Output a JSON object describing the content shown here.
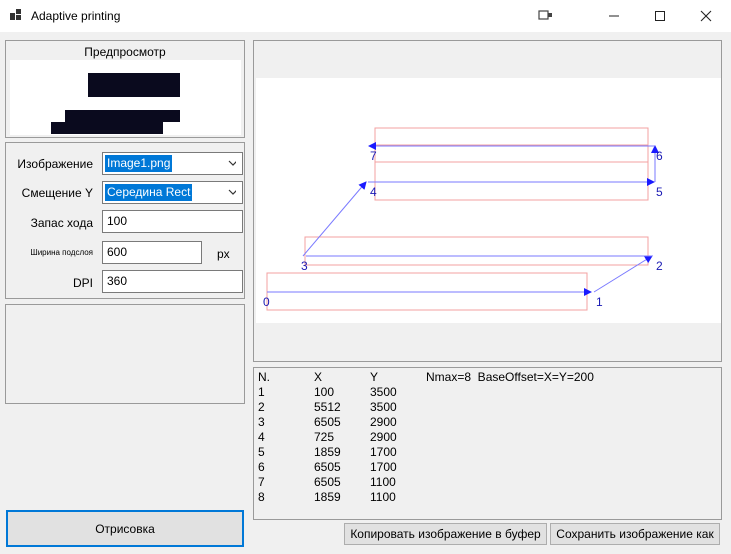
{
  "window": {
    "title": "Adaptive printing",
    "controls": [
      "minimize-icon",
      "maximize-icon",
      "close-icon"
    ]
  },
  "preview": {
    "title": "Предпросмотр"
  },
  "settings": {
    "image_label": "Изображение",
    "image_value": "Image1.png",
    "offset_label": "Смещение Y",
    "offset_value": "Середина Rect",
    "stroke_label": "Запас хода",
    "stroke_value": "100",
    "sublayer_label": "Ширина подслоя",
    "sublayer_value": "600",
    "sublayer_unit": "px",
    "dpi_label": "DPI",
    "dpi_value": "360"
  },
  "draw_button": "Отрисовка",
  "path": {
    "labels": [
      "0",
      "1",
      "2",
      "3",
      "4",
      "5",
      "6",
      "7"
    ]
  },
  "table": {
    "headers": [
      "N.",
      "X",
      "Y"
    ],
    "summary": "Nmax=8  BaseOffset=X=Y=200",
    "rows": [
      [
        "1",
        "100",
        "3500"
      ],
      [
        "2",
        "5512",
        "3500"
      ],
      [
        "3",
        "6505",
        "2900"
      ],
      [
        "4",
        "725",
        "2900"
      ],
      [
        "5",
        "1859",
        "1700"
      ],
      [
        "6",
        "6505",
        "1700"
      ],
      [
        "7",
        "6505",
        "1100"
      ],
      [
        "8",
        "1859",
        "1100"
      ]
    ]
  },
  "actions": {
    "copy_button": "Копировать изображение в буфер",
    "save_button": "Сохранить изображение как"
  }
}
